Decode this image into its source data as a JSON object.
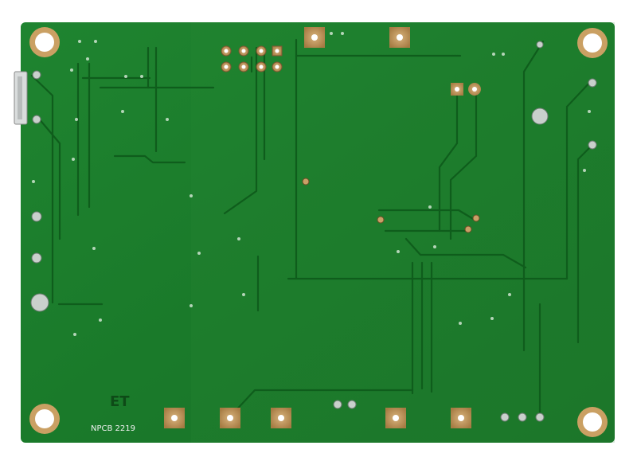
{
  "board": {
    "silkscreen_label": "NPCB 2219",
    "silkscreen_logo": "ET",
    "colors": {
      "background": "#ffffff",
      "soldermask": "#1b7a2a",
      "soldermask_light": "#2a8f37",
      "trace": "#0f5d1c",
      "copper_pad": "#c9a067",
      "copper_pad_dark": "#8f6a39",
      "silkscreen": "#f2f2f2",
      "hole": "#ffffff"
    }
  }
}
